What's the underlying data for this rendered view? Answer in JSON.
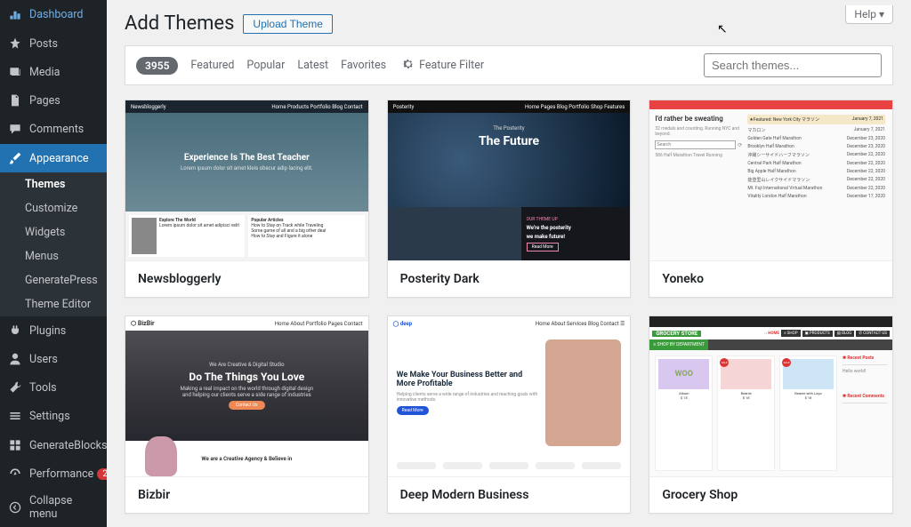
{
  "help_label": "Help ▾",
  "page_title": "Add Themes",
  "upload_label": "Upload Theme",
  "filter": {
    "count": "3955",
    "featured": "Featured",
    "popular": "Popular",
    "latest": "Latest",
    "favorites": "Favorites",
    "feature_filter": "Feature Filter"
  },
  "search_placeholder": "Search themes...",
  "sidebar": {
    "dashboard": "Dashboard",
    "posts": "Posts",
    "media": "Media",
    "pages": "Pages",
    "comments": "Comments",
    "appearance": "Appearance",
    "plugins": "Plugins",
    "users": "Users",
    "tools": "Tools",
    "settings": "Settings",
    "generateblocks": "GenerateBlocks",
    "performance": "Performance",
    "performance_badge": "2",
    "collapse": "Collapse menu"
  },
  "submenu": {
    "themes": "Themes",
    "customize": "Customize",
    "widgets": "Widgets",
    "menus": "Menus",
    "generatepress": "GeneratePress",
    "theme_editor": "Theme Editor"
  },
  "themes": [
    {
      "name": "Newsbloggerly",
      "hero_title": "Experience Is The Best Teacher",
      "hero_sub": "Lorem ipsum dolor sit amet kleis obscur adip lacing elit.",
      "card1": "Explore The World",
      "card2": "Popular Articles"
    },
    {
      "name": "Posterity Dark",
      "hero_over": "The Posterity",
      "hero_title": "The Future",
      "tag": "OUR THEME UP",
      "line1": "We're the posterity",
      "line2": "we make future!",
      "btn": "Read More"
    },
    {
      "name": "Yoneko",
      "featured": "★Featured: New York City マラソン",
      "left_title": "I'd rather be sweating",
      "left_sub": "32 medals and counting. Running NYC and beyond.",
      "search": "Search",
      "rows": [
        {
          "l": "マカロン",
          "r": "January 7, 2021"
        },
        {
          "l": "Golden Gate Half Marathon",
          "r": "December 23, 2020"
        },
        {
          "l": "Brooklyn Half Marathon",
          "r": "December 23, 2020"
        },
        {
          "l": "沖縄シーサイドハーフマラソン",
          "r": "December 22, 2020"
        },
        {
          "l": "Central Park Half Marathon",
          "r": "December 22, 2020"
        },
        {
          "l": "Big Apple Half Marathon",
          "r": "December 22, 2020"
        },
        {
          "l": "能登里山レイクサイドマラソン",
          "r": "December 22, 2020"
        },
        {
          "l": "Mt. Fuji International Virtual Marathon",
          "r": "December 22, 2020"
        },
        {
          "l": "Vitality London Half Marathon",
          "r": "December 17, 2020"
        }
      ],
      "tags": "586   Half Marathon   Travel Running"
    },
    {
      "name": "Bizbir",
      "brand": "BizBir",
      "hero_over": "We Are Creative & Digital Studio",
      "hero_title": "Do The Things You Love",
      "bottom": "We are a Creative Agency & Believe in"
    },
    {
      "name": "Deep Modern Business",
      "hero_title": "We Make Your Business Better and More Profitable",
      "cta": "Read More"
    },
    {
      "name": "Grocery Shop",
      "logo": "GROCERY STORE",
      "home": "⌂ HOME",
      "dept": "≡ SHOP BY DEPARTMENT",
      "nav": [
        "≡ SHOP",
        "▣ PRODUCTS",
        "▤ BLOG",
        "✆ CONTACT US"
      ],
      "products": [
        "Album",
        "Beanie",
        "Beanie with Logo"
      ],
      "sale": "SALE",
      "side1": "✱ Recent Posts",
      "side2": "✱ Recent Comments"
    }
  ]
}
